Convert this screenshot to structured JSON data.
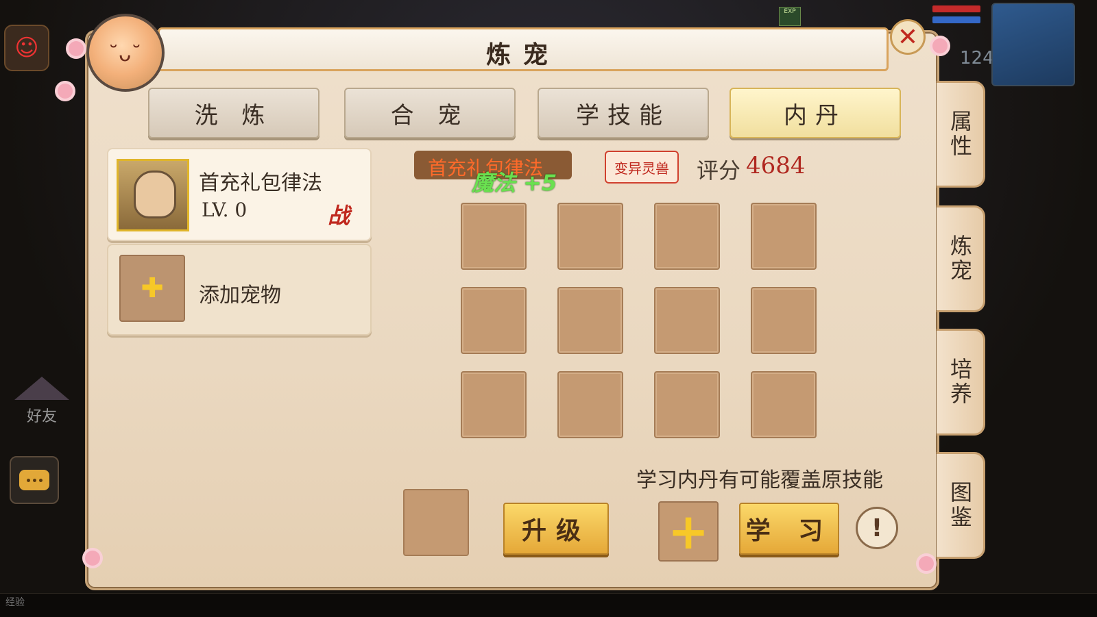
{
  "hud": {
    "friend_label": "好友",
    "exp_badge": "EXP",
    "level_value": "124",
    "bottom_label": "经验"
  },
  "window": {
    "title": "炼宠"
  },
  "tabs": [
    {
      "label": "洗 炼",
      "active": false
    },
    {
      "label": "合 宠",
      "active": false
    },
    {
      "label": "学技能",
      "active": false
    },
    {
      "label": "内丹",
      "active": true
    }
  ],
  "side_tabs": [
    {
      "label": "属性"
    },
    {
      "label": "炼宠"
    },
    {
      "label": "培养"
    },
    {
      "label": "图鉴"
    }
  ],
  "pet_list": {
    "selected_pet": {
      "name": "首充礼包律法",
      "level": "LV. 0",
      "status": "战"
    },
    "add_pet_label": "添加宠物"
  },
  "pet_info": {
    "skill_tag_text": "首充礼包律法",
    "bonus_text": "魔法 +5",
    "mutant_badge": "变异灵兽",
    "score_label": "评分",
    "score_value": "4684"
  },
  "hint_text": "学习内丹有可能覆盖原技能",
  "buttons": {
    "upgrade": "升级",
    "learn": "学 习",
    "add": "+",
    "info": "!"
  },
  "colors": {
    "panel_bg": "#ead8c0",
    "slot": "#c59a72",
    "gold_button": "#f0c050",
    "score": "#b02820",
    "close": "#c0281e"
  }
}
